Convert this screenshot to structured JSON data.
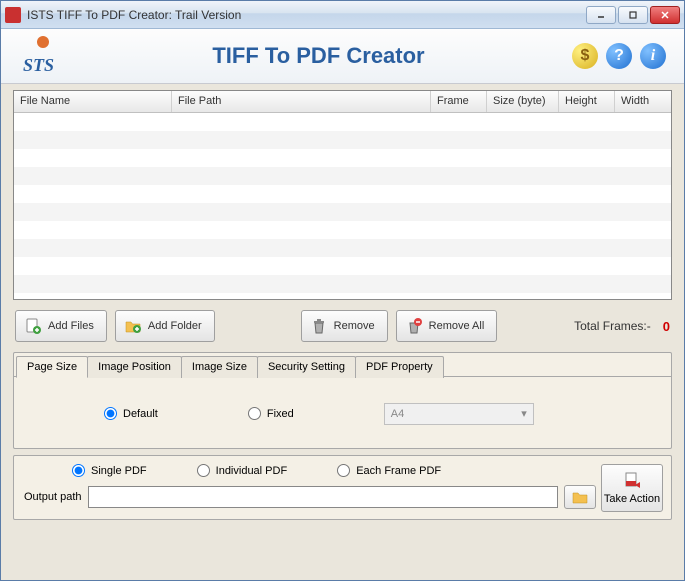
{
  "window": {
    "title": "ISTS TIFF To PDF Creator: Trail Version"
  },
  "header": {
    "logo_text": "STS",
    "app_title": "TIFF To PDF Creator",
    "icons": {
      "dollar": "$",
      "help": "?",
      "info": "i"
    }
  },
  "grid": {
    "columns": [
      "File Name",
      "File Path",
      "Frame",
      "Size (byte)",
      "Height",
      "Width"
    ],
    "rows": []
  },
  "toolbar": {
    "add_files": "Add  Files",
    "add_folder": "Add  Folder",
    "remove": "Remove",
    "remove_all": "Remove All",
    "total_frames_label": "Total Frames:-",
    "total_frames_value": "0"
  },
  "tabs": {
    "items": [
      "Page Size",
      "Image Position",
      "Image Size",
      "Security Setting",
      "PDF Property"
    ],
    "active": 0,
    "page_size": {
      "default_label": "Default",
      "fixed_label": "Fixed",
      "selected": "default",
      "preset": "A4"
    }
  },
  "output": {
    "mode": {
      "single": "Single PDF",
      "individual": "Individual PDF",
      "each_frame": "Each Frame PDF",
      "selected": "single"
    },
    "path_label": "Output path",
    "path_value": "",
    "take_action": "Take Action"
  }
}
